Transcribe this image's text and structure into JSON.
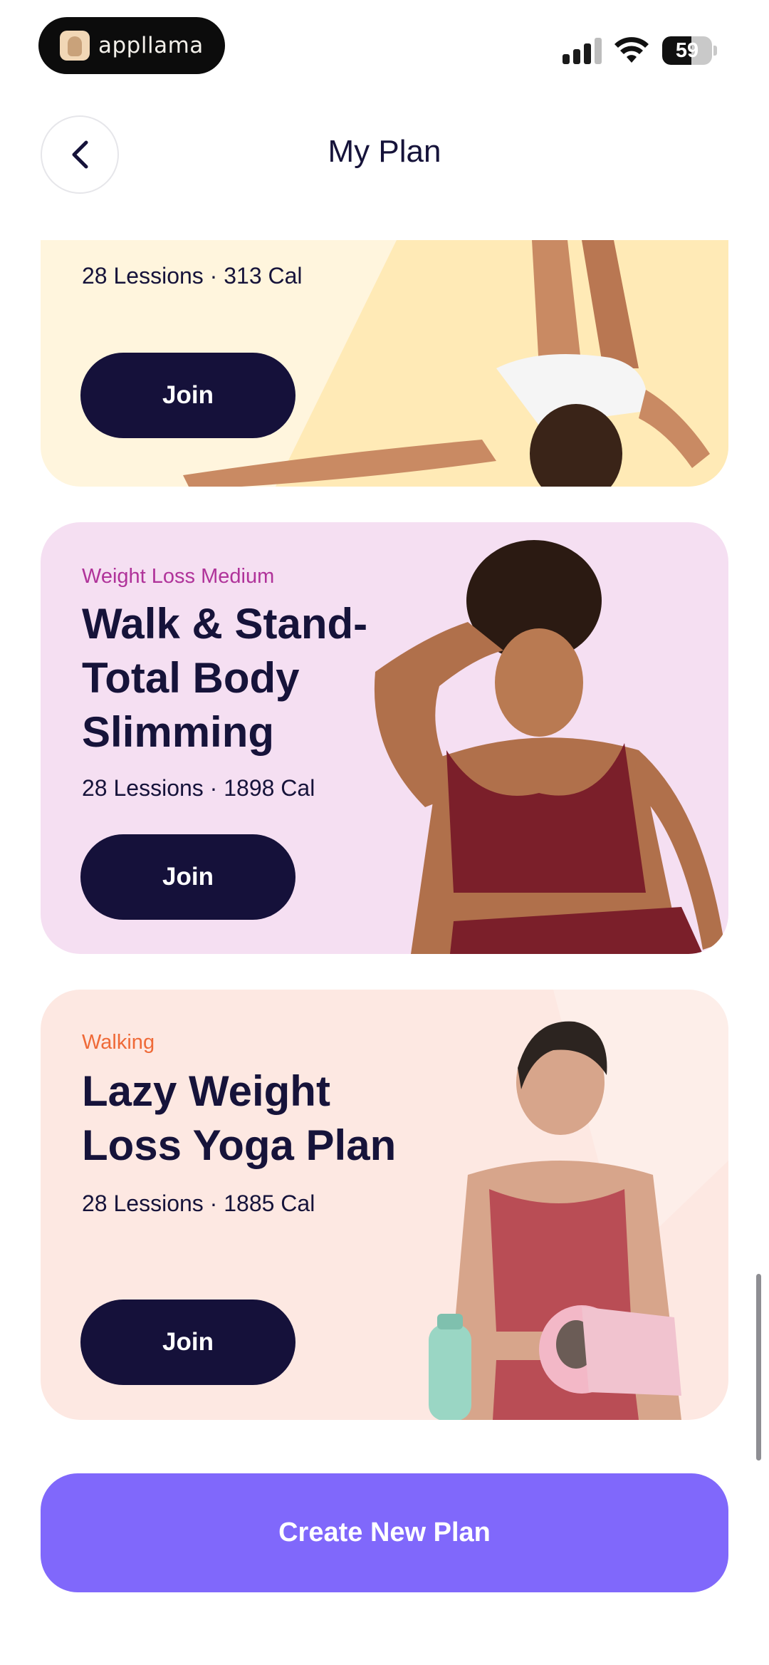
{
  "status_bar": {
    "brand_name": "appllama",
    "battery_level": "59",
    "battery_fraction": 0.59
  },
  "header": {
    "title": "My Plan",
    "back_icon": "chevron-left-icon"
  },
  "plans": [
    {
      "tag": "",
      "title": "",
      "meta": "28 Lessions · 313 Cal",
      "button": "Join",
      "background": "#fff5dd"
    },
    {
      "tag": "Weight Loss Medium",
      "tag_color": "#b0339a",
      "title": "Walk & Stand-Total Body Slimming",
      "meta": "28 Lessions · 1898 Cal",
      "button": "Join",
      "background": "#f5dff2"
    },
    {
      "tag": "Walking",
      "tag_color": "#ef6a38",
      "title": "Lazy Weight Loss Yoga Plan",
      "meta": "28 Lessions · 1885 Cal",
      "button": "Join",
      "background": "#fde8e2"
    }
  ],
  "create_button": "Create New Plan",
  "colors": {
    "primary_dark": "#15113a",
    "accent_purple": "#8068fb"
  }
}
